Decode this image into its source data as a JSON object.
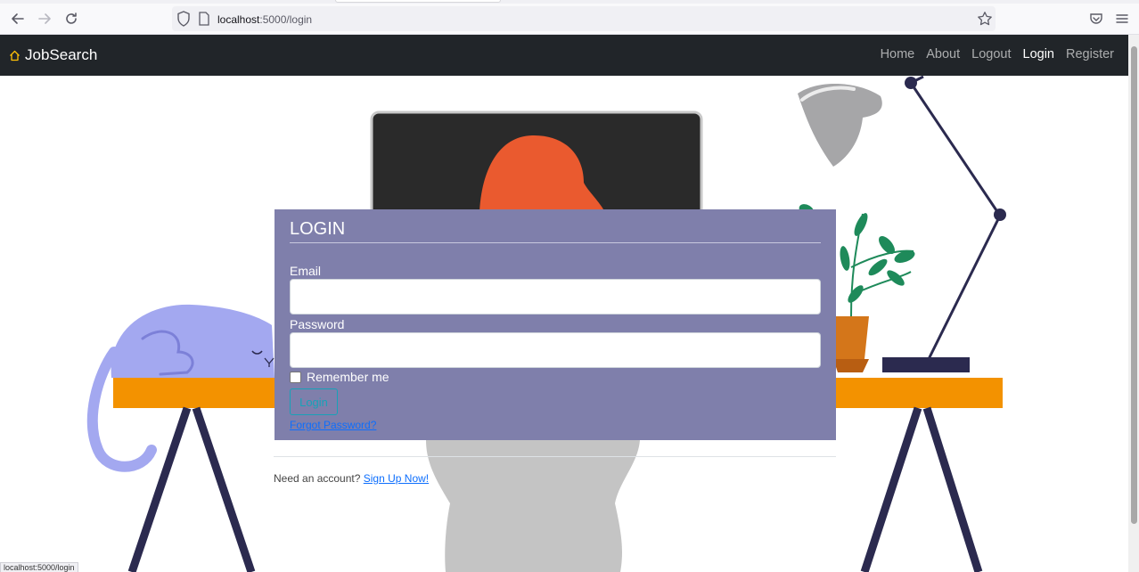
{
  "browser": {
    "url_host": "localhost",
    "url_path": ":5000/login",
    "status_url": "localhost:5000/login"
  },
  "navbar": {
    "brand": "JobSearch",
    "links": [
      {
        "label": "Home"
      },
      {
        "label": "About"
      },
      {
        "label": "Logout"
      },
      {
        "label": "Login",
        "active": true
      },
      {
        "label": "Register"
      }
    ]
  },
  "login_form": {
    "title": "LOGIN",
    "email_label": "Email",
    "email_value": "",
    "password_label": "Password",
    "password_value": "",
    "remember_label": "Remember me",
    "remember_checked": false,
    "submit_label": "Login",
    "forgot_label": "Forgot Password?"
  },
  "signup": {
    "prompt": "Need an account?",
    "link_label": "Sign Up Now!"
  },
  "colors": {
    "navbar_bg": "#212529",
    "card_bg": "#7f7fab",
    "accent_btn": "#17a2b8",
    "link": "#0d6efd",
    "desk": "#f39200",
    "cat": "#a3a8f0"
  }
}
